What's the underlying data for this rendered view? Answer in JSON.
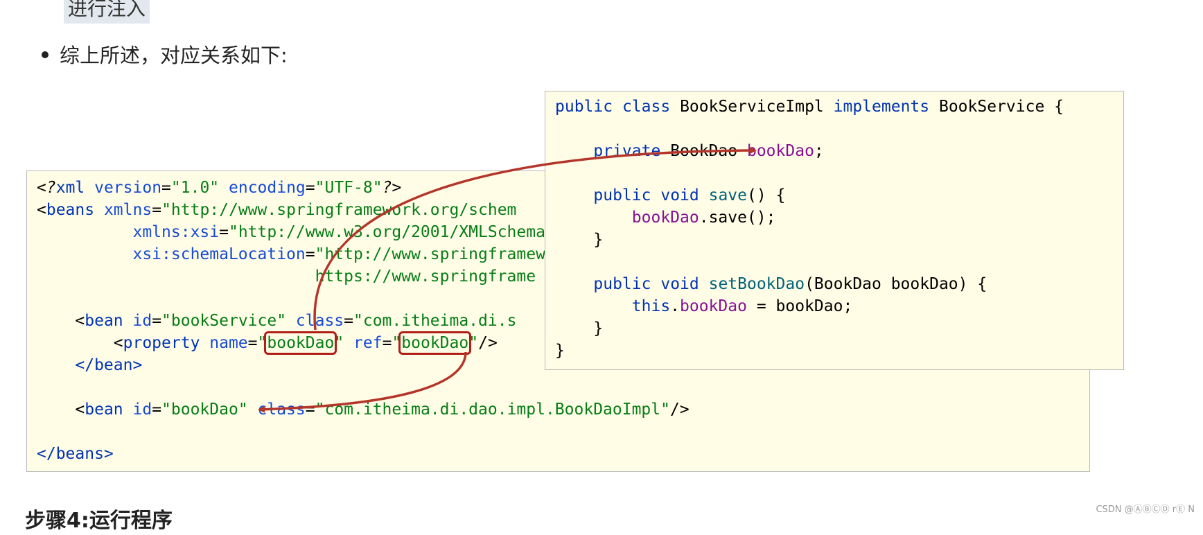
{
  "doc": {
    "top_line": "进行注入",
    "bullet": "综上所述，对应关系如下:",
    "next_heading": "步骤4:运行程序",
    "watermark": "CSDN @ⒶⒷⒸⒹ rⒺ N"
  },
  "xml_code": {
    "l1_open": "<",
    "l1_q": "?",
    "l1_tag": "xml",
    "l1_a1": " version",
    "l1_eq1": "=",
    "l1_v1": "\"1.0\"",
    "l1_a2": " encoding",
    "l1_eq2": "=",
    "l1_v2": "\"UTF-8\"",
    "l1_close": "?>",
    "l2_open": "<",
    "l2_tag": "beans",
    "l2_a": " xmlns",
    "l2_eq": "=",
    "l2_v": "\"http://www.springframework.org/schem",
    "l3_a": "xmlns:xsi",
    "l3_eq": "=",
    "l3_v": "\"http://www.w3.org/2001/XMLSchema",
    "l4_a": "xsi:schemaLocation",
    "l4_eq": "=",
    "l4_v": "\"http://www.springframew",
    "l5_v": "https://www.springframe",
    "l7_open": "<",
    "l7_tag": "bean",
    "l7_a1": " id",
    "l7_eq1": "=",
    "l7_v1": "\"bookService\"",
    "l7_a2": " class",
    "l7_eq2": "=",
    "l7_v2": "\"com.itheima.di.s",
    "l8_open": "<",
    "l8_tag": "property",
    "l8_a1": " name",
    "l8_eq1": "=",
    "l8_q1": "\"",
    "l8_name_val": "bookDao",
    "l8_q2": "\"",
    "l8_a2": " ref",
    "l8_eq2": "=",
    "l8_q3": "\"",
    "l8_ref_val": "bookDao",
    "l8_q4": "\"",
    "l8_close": "/>",
    "l9": "</bean>",
    "l11_open": "<",
    "l11_tag": "bean",
    "l11_a1": " id",
    "l11_eq1": "=",
    "l11_v1": "\"bookDao\"",
    "l11_a2": " class",
    "l11_eq2": "=",
    "l11_v2": "\"com.itheima.di.dao.impl.BookDaoImpl\"",
    "l11_close": "/>",
    "l13": "</beans>"
  },
  "java_code": {
    "l1_kw1": "public",
    "l1_kw2": "class",
    "l1_name": "BookServiceImpl",
    "l1_kw3": "implements",
    "l1_iface": "BookService {",
    "l3_kw": "private",
    "l3_type": "BookDao",
    "l3_field": "bookDao",
    "l3_end": ";",
    "l5_kw1": "public",
    "l5_kw2": "void",
    "l5_method": "save",
    "l5_end": "() {",
    "l6_field": "bookDao",
    "l6_rest": ".save();",
    "l7": "}",
    "l9_kw1": "public",
    "l9_kw2": "void",
    "l9_method": "setBookDao",
    "l9_params": "(BookDao bookDao) {",
    "l10_kw": "this",
    "l10_dot": ".",
    "l10_field": "bookDao",
    "l10_rest": " = bookDao;",
    "l11": "}",
    "l12": "}"
  },
  "colors": {
    "box_bg": "#fffde6",
    "keyword": "#0033b3",
    "string": "#067d17",
    "field": "#871094",
    "highlight_border": "#b01e16",
    "arrow": "#b4362b"
  }
}
